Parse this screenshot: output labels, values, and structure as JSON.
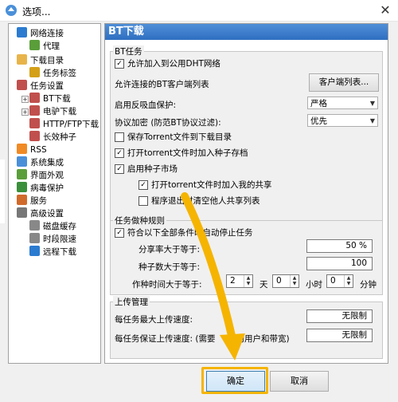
{
  "window": {
    "title": "选项...",
    "close_glyph": "✕"
  },
  "tree": {
    "items": [
      {
        "label": "网络连接",
        "icon": "globe-icon",
        "color": "#2b7bd0"
      },
      {
        "label": "代理",
        "icon": "proxy-icon",
        "color": "#5a9e3a"
      },
      {
        "label": "下载目录",
        "icon": "folder-icon",
        "color": "#e8b44a"
      },
      {
        "label": "任务标签",
        "icon": "tag-icon",
        "color": "#d4a017"
      },
      {
        "label": "任务设置",
        "icon": "task-settings-icon",
        "color": "#c0504d"
      },
      {
        "label": "BT下载",
        "icon": "bt-icon",
        "color": "#c0504d"
      },
      {
        "label": "电驴下载",
        "icon": "emule-icon",
        "color": "#c0504d"
      },
      {
        "label": "HTTP/FTP下载",
        "icon": "http-icon",
        "color": "#c0504d"
      },
      {
        "label": "长效种子",
        "icon": "seed-icon",
        "color": "#c0504d"
      },
      {
        "label": "RSS",
        "icon": "rss-icon",
        "color": "#f08a24"
      },
      {
        "label": "系统集成",
        "icon": "integration-icon",
        "color": "#4a90d9"
      },
      {
        "label": "界面外观",
        "icon": "appearance-icon",
        "color": "#5a9e3a"
      },
      {
        "label": "病毒保护",
        "icon": "shield-icon",
        "color": "#3a8f3a"
      },
      {
        "label": "服务",
        "icon": "service-icon",
        "color": "#d06a2b"
      },
      {
        "label": "高级设置",
        "icon": "advanced-icon",
        "color": "#777777"
      },
      {
        "label": "磁盘缓存",
        "icon": "disk-icon",
        "color": "#888888"
      },
      {
        "label": "时段限速",
        "icon": "clock-icon",
        "color": "#888888"
      },
      {
        "label": "远程下载",
        "icon": "remote-icon",
        "color": "#2b7bd0"
      }
    ]
  },
  "panel": {
    "header": "BT下载",
    "bt_task": {
      "title": "BT任务",
      "dht_label": "允许加入到公用DHT网络",
      "dht_checked": "✓",
      "client_list_label": "允许连接的BT客户端列表",
      "client_list_button": "客户端列表...",
      "anti_leech_label": "启用反吸血保护:",
      "anti_leech_value": "严格",
      "encrypt_label": "协议加密 (防范BT协议过滤):",
      "encrypt_value": "优先",
      "save_torrent_label": "保存Torrent文件到下载目录",
      "open_torrent_label": "打开torrent文件时加入种子存档",
      "open_torrent_checked": "✓",
      "seed_market_label": "启用种子市场",
      "seed_market_checked": "✓",
      "join_share_label": "打开torrent文件时加入我的共享",
      "join_share_checked": "✓",
      "clear_share_label": "程序退出时清空他人共享列表"
    },
    "seed_rules": {
      "title": "任务做种规则",
      "auto_stop_label": "符合以下全部条件时自动停止任务",
      "auto_stop_checked": "✓",
      "ratio_label": "分享率大于等于:",
      "ratio_value": "50 %",
      "seeds_label": "种子数大于等于:",
      "seeds_value": "100",
      "time_label": "作种时间大于等于:",
      "days_value": "2",
      "days_unit": "天",
      "hours_value": "0",
      "hours_unit": "小时",
      "minutes_value": "0",
      "minutes_unit": "分钟"
    },
    "upload": {
      "title": "上传管理",
      "max_upload_label": "每任务最大上传速度:",
      "max_upload_value": "无限制",
      "min_upload_label": "每任务保证上传速度: (需要",
      "min_upload_label_tail": "的用户和带宽)",
      "min_upload_value": "无限制"
    }
  },
  "buttons": {
    "ok": "确定",
    "cancel": "取消"
  },
  "colors": {
    "highlight": "#f5b400",
    "header": "#3a7ccb"
  }
}
